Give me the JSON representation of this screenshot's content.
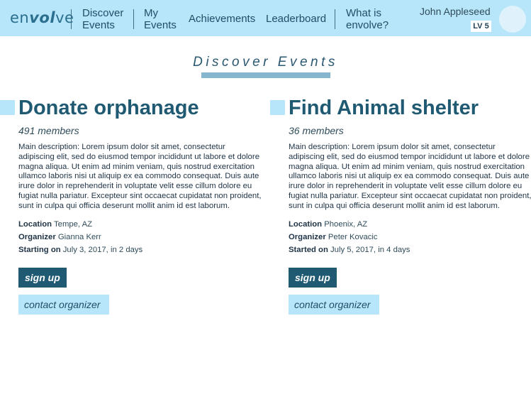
{
  "header": {
    "logo": {
      "prefix": "en",
      "middle": "vol",
      "suffix": "ve"
    },
    "nav": [
      {
        "label_line1": "Discover",
        "label_line2": "Events"
      },
      {
        "label_line1": "My",
        "label_line2": "Events"
      },
      {
        "label": "Achievements"
      },
      {
        "label": "Leaderboard"
      },
      {
        "label_line1": "What is",
        "label_line2": "envolve?"
      }
    ],
    "user": {
      "name": "John Appleseed",
      "level": "LV 5"
    }
  },
  "page": {
    "title": "Discover Events"
  },
  "events": [
    {
      "title": "Donate orphanage",
      "members": "491 members",
      "description": "Main description: Lorem ipsum dolor sit amet, consectetur adipiscing elit, sed do eiusmod tempor incididunt ut labore et dolore magna aliqua. Ut enim ad minim veniam, quis nostrud exercitation ullamco laboris nisi ut aliquip ex ea commodo consequat. Duis aute irure dolor in reprehenderit in voluptate velit esse cillum dolore eu fugiat nulla pariatur. Excepteur sint occaecat cupidatat non proident, sunt in culpa qui officia deserunt mollit anim id est laborum.",
      "location_label": "Location",
      "location": "Tempe, AZ",
      "organizer_label": "Organizer",
      "organizer": "Gianna Kerr",
      "start_label": "Starting on",
      "start": "July 3, 2017, in 2 days",
      "signup_label": "sign up",
      "contact_label": "contact organizer"
    },
    {
      "title": "Find Animal shelter",
      "members": "36 members",
      "description": "Main description: Lorem ipsum dolor sit amet, consectetur adipiscing elit, sed do eiusmod tempor incididunt ut labore et dolore magna aliqua. Ut enim ad minim veniam, quis nostrud exercitation ullamco laboris nisi ut aliquip ex ea commodo consequat. Duis aute irure dolor in reprehenderit in voluptate velit esse cillum dolore eu fugiat nulla pariatur. Excepteur sint occaecat cupidatat non proident, sunt in culpa qui officia deserunt mollit anim id est laborum.",
      "location_label": "Location",
      "location": "Phoenix, AZ",
      "organizer_label": "Organizer",
      "organizer": "Peter Kovacic",
      "start_label": "Started on",
      "start": "July 5, 2017, in 4 days",
      "signup_label": "sign up",
      "contact_label": "contact organizer"
    }
  ],
  "colors": {
    "header_bg": "#b7e6fb",
    "primary": "#1f5a72",
    "accent_light": "#b7e6fb",
    "underline": "#86b5ce"
  }
}
